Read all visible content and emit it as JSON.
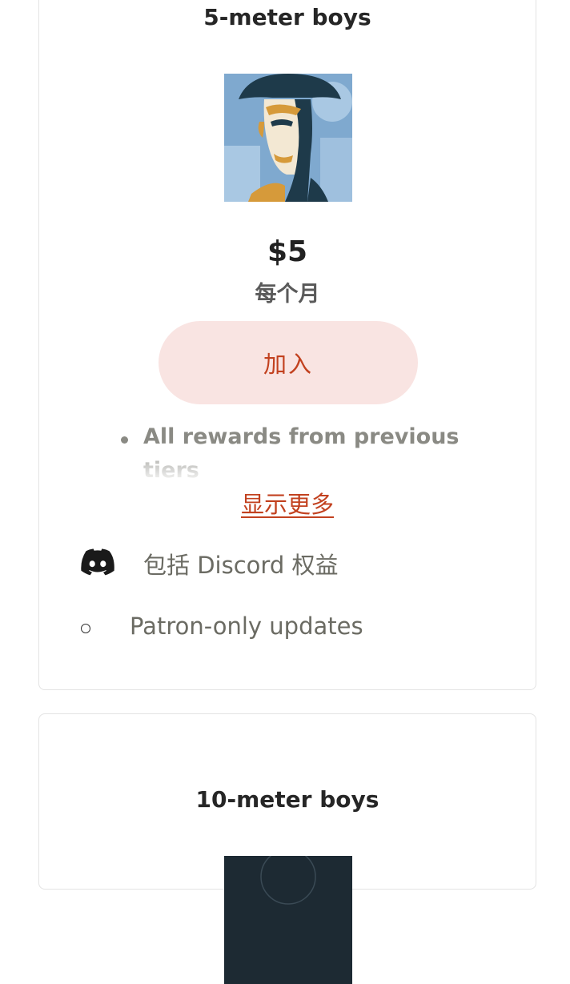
{
  "tiers": [
    {
      "title": "5-meter boys",
      "price": "$5",
      "period": "每个月",
      "join_label": "加入",
      "rewards": [
        "All rewards from previous tiers"
      ],
      "show_more_label": "显示更多",
      "perks": [
        {
          "icon": "discord-icon",
          "label": "包括 Discord 权益"
        },
        {
          "icon": "circle-bullet-icon",
          "label": "Patron-only updates"
        }
      ]
    },
    {
      "title": "10-meter boys"
    }
  ],
  "colors": {
    "accent": "#c2411f",
    "button_bg": "#f9e4e2",
    "muted_text": "#6b6b63",
    "border": "#e3e3e3"
  }
}
